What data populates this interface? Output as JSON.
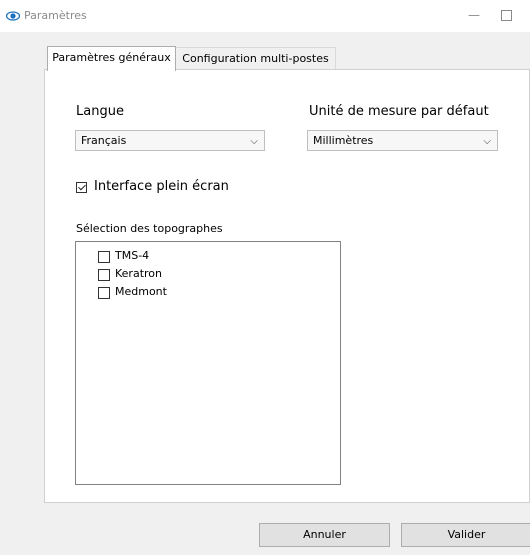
{
  "window": {
    "title": "Paramètres",
    "minimize_glyph": "—",
    "close_glyph": "✕"
  },
  "tabs": [
    {
      "label": "Paramètres généraux",
      "active": true
    },
    {
      "label": "Configuration multi-postes",
      "active": false
    }
  ],
  "general": {
    "language_label": "Langue",
    "language_value": "Français",
    "unit_label": "Unité de mesure par défaut",
    "unit_value": "Millimètres",
    "fullscreen_label": "Interface plein écran",
    "fullscreen_checked": true,
    "topographers_label": "Sélection des topographes",
    "topographers": [
      {
        "label": "TMS-4",
        "checked": false
      },
      {
        "label": "Keratron",
        "checked": false
      },
      {
        "label": "Medmont",
        "checked": false
      }
    ]
  },
  "buttons": {
    "cancel": "Annuler",
    "ok": "Valider"
  },
  "icons": {
    "app": "eye-icon",
    "dropdown": "chevron-down-icon"
  },
  "colors": {
    "app_icon": "#1a6fc0"
  }
}
